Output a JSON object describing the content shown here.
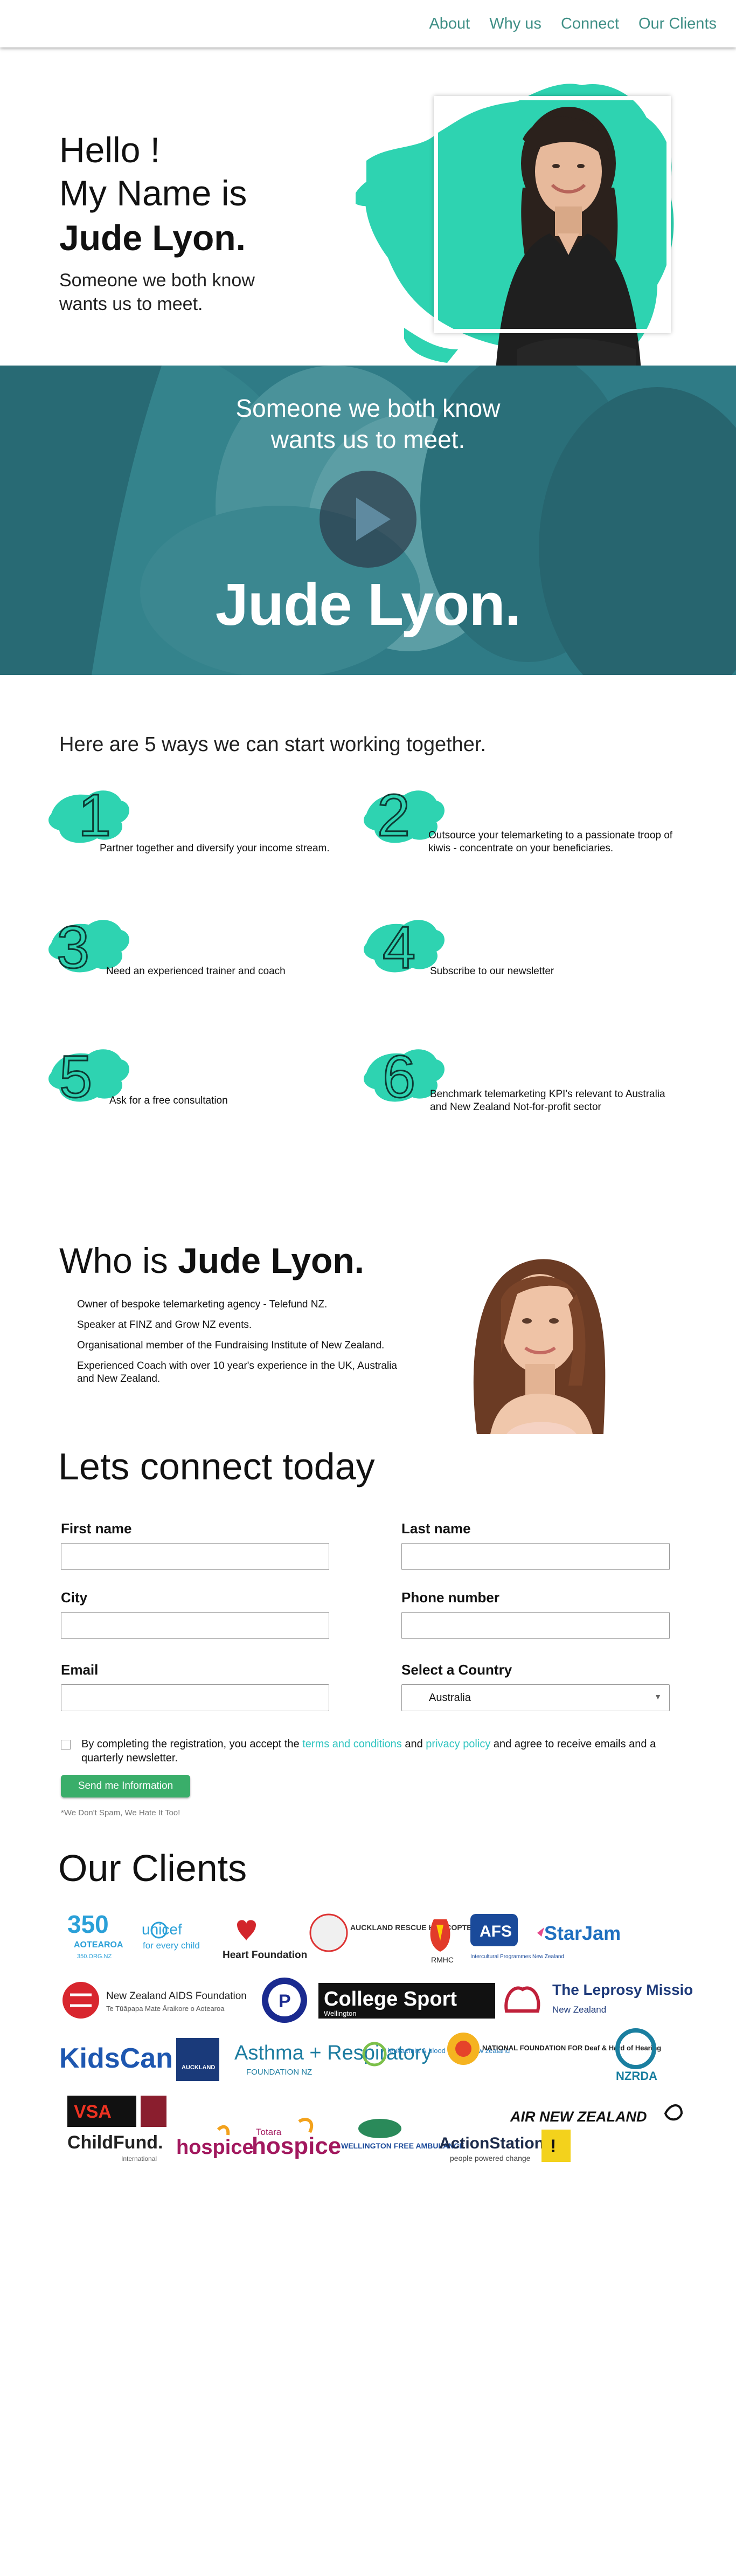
{
  "nav": {
    "items": [
      "About",
      "Why us",
      "Connect",
      "Our Clients"
    ]
  },
  "hero": {
    "hello": "Hello !",
    "intro": "My Name is",
    "name": "Jude Lyon.",
    "subtitle": "Someone we both know wants us to meet."
  },
  "video": {
    "subtitle_line1": "Someone we both know",
    "subtitle_line2": "wants us to meet.",
    "name": "Jude Lyon."
  },
  "ways": {
    "title": "Here are 5 ways we can start working together.",
    "items": [
      {
        "number": "1",
        "label": "Partner together and diversify your income stream."
      },
      {
        "number": "2",
        "label": "Outsource your telemarketing to a passionate troop of kiwis - concentrate on your beneficiaries."
      },
      {
        "number": "3",
        "label": "Need an experienced trainer and coach"
      },
      {
        "number": "4",
        "label": "Subscribe to our newsletter"
      },
      {
        "number": "5",
        "label": "Ask for a free consultation"
      },
      {
        "number": "6",
        "label": "Benchmark telemarketing KPI's relevant to Australia and New Zealand Not-for-profit sector"
      }
    ]
  },
  "who": {
    "title_prefix": "Who is",
    "title_name": "Jude Lyon.",
    "items": [
      "Owner of bespoke telemarketing agency - Telefund NZ.",
      "Speaker at FINZ and Grow NZ events.",
      "Organisational member of the Fundraising Institute of New Zealand.",
      "Experienced Coach with over 10 year's experience in the UK, Australia and New Zealand."
    ]
  },
  "form": {
    "title": "Lets connect today",
    "first_name_label": "First name",
    "last_name_label": "Last name",
    "city_label": "City",
    "phone_label": "Phone number",
    "email_label": "Email",
    "country_label": "Select a Country",
    "country_value": "Australia",
    "consent_before": "By completing the registration, you accept the",
    "consent_terms": "terms and conditions",
    "consent_and": "and",
    "consent_privacy": "privacy policy",
    "consent_after": "and agree to receive emails and a quarterly newsletter.",
    "submit_label": "Send me Information",
    "nospam": "*We Don't Spam, We Hate It Too!"
  },
  "clients": {
    "title": "Our Clients",
    "logos": {
      "l350": "350",
      "l350_sub": "AOTEAROA",
      "l350_url": "350.ORG.NZ",
      "unicef": "unicef",
      "unicef_sub": "for every child",
      "heart": "Heart Foundation",
      "rescue": "AUCKLAND RESCUE HELICOPTER TRUST",
      "rmhc": "RMHC",
      "afs": "AFS",
      "afs_sub": "Intercultural Programmes New Zealand",
      "starjam": "StarJam",
      "aids": "New Zealand AIDS Foundation",
      "aids_sub": "Te Tūāpapa Mate Āraikore o Aotearoa",
      "college": "College Sport",
      "college_sub": "Wellington",
      "leprosy": "The Leprosy Mission",
      "leprosy_sub": "New Zealand",
      "kidscan": "KidsCan",
      "auckland": "AUCKLAND",
      "asthma": "Asthma + Respiratory",
      "asthma_sub": "FOUNDATION NZ",
      "leukaemia": "leukaemia & blood cancer new zealand",
      "deaf": "NATIONAL FOUNDATION FOR Deaf & Hard of Hearing",
      "nzrda": "NZRDA",
      "vsa": "VSA",
      "airnz": "AIR NEW ZEALAND",
      "childfund": "ChildFund.",
      "childfund_sub": "International",
      "hospice1": "hospice",
      "totara": "Totara",
      "hospice2": "hospice",
      "ambulance": "WELLINGTON FREE AMBULANCE",
      "actionstation": "ActionStation",
      "actionstation_sub": "people powered change"
    }
  },
  "colors": {
    "accent": "#2ed3b1",
    "nav_link": "#3f8f86",
    "video_tint": "#2f7b86",
    "submit": "#3aae6a",
    "link": "#2fc4c0"
  }
}
